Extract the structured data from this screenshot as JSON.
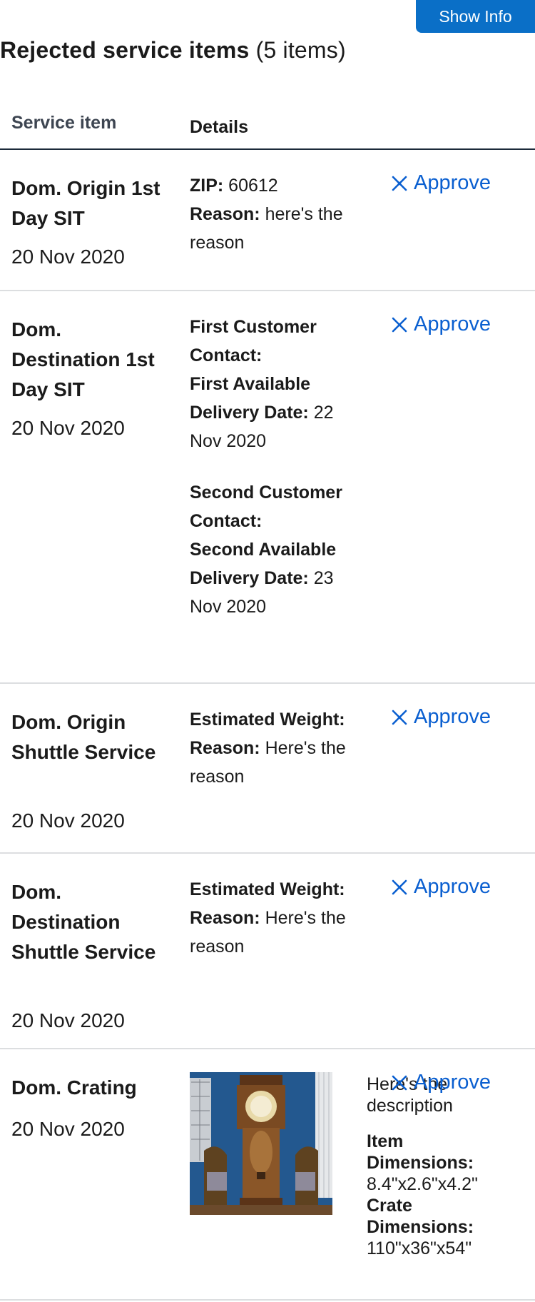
{
  "header": {
    "show_info_label": "Show Info"
  },
  "section": {
    "title": "Rejected service items",
    "count": "(5 items)"
  },
  "table": {
    "col_item": "Service item",
    "col_details": "Details",
    "approve_label": "Approve",
    "rows": [
      {
        "name": "Dom. Origin 1st Day SIT",
        "date": "20 Nov 2020",
        "zip_label": "ZIP:",
        "zip": "60612",
        "reason_label": "Reason:",
        "reason": "here's the reason"
      },
      {
        "name": "Dom. Destination 1st Day SIT",
        "date": "20 Nov 2020",
        "first_contact_label": "First Customer Contact:",
        "first_delivery_label": "First Available Delivery Date:",
        "first_delivery": "22 Nov 2020",
        "second_contact_label": "Second Customer Contact:",
        "second_delivery_label": "Second Available Delivery Date:",
        "second_delivery": "23 Nov 2020"
      },
      {
        "name": "Dom. Origin Shuttle Service",
        "date": "20 Nov 2020",
        "weight_label": "Estimated Weight:",
        "reason_label": "Reason:",
        "reason": "Here's the reason"
      },
      {
        "name": "Dom. Destination Shuttle Service",
        "date": "20 Nov 2020",
        "weight_label": "Estimated Weight:",
        "reason_label": "Reason:",
        "reason": "Here's the reason"
      },
      {
        "name": "Dom. Crating",
        "date": "20 Nov 2020",
        "description": "Here's the description",
        "item_dim_label": "Item Dimensions:",
        "item_dim": "8.4\"x2.6\"x4.2\"",
        "crate_dim_label": "Crate Dimensions:",
        "crate_dim": "110\"x36\"x54\""
      }
    ]
  },
  "colors": {
    "accent": "#0a6fc7",
    "link": "#0a5fd0",
    "divider": "#dcdee0",
    "header_rule": "#1b2a3a"
  },
  "icons": {
    "approve": "close-x-icon"
  }
}
